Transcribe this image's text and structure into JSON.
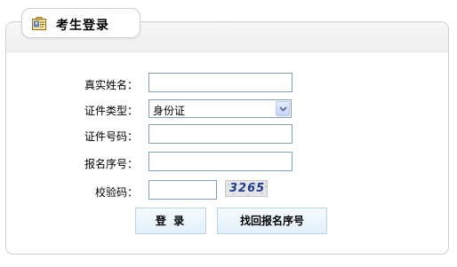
{
  "tab": {
    "title": "考生登录",
    "icon": "id-card-icon"
  },
  "form": {
    "name_label": "真实姓名：",
    "name_value": "",
    "id_type_label": "证件类型：",
    "id_type_value": "身份证",
    "id_number_label": "证件号码：",
    "id_number_value": "",
    "reg_number_label": "报名序号：",
    "reg_number_value": "",
    "captcha_label": "校验码：",
    "captcha_value": "",
    "captcha_image_text": "3265"
  },
  "buttons": {
    "login": "登  录",
    "recover": "找回报名序号"
  },
  "colors": {
    "field_border": "#7f9db9",
    "button_border": "#b9d3e6",
    "captcha_text": "#1f3a8c"
  }
}
